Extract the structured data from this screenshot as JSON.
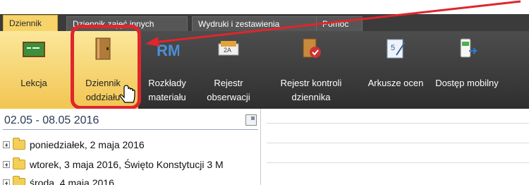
{
  "menu": {
    "tabs": [
      {
        "label": "Dziennik"
      },
      {
        "label": "Dziennik zajęć innych"
      },
      {
        "label": "Wydruki i zestawienia"
      },
      {
        "label": "Pomoc"
      }
    ]
  },
  "ribbon": {
    "buttons": [
      {
        "label": "Lekcja",
        "icon": "lesson-board-icon"
      },
      {
        "label": "Dziennik oddziału",
        "icon": "class-journal-book-icon"
      },
      {
        "label": "Rozkłady materiału",
        "icon": "rm-syllabus-icon"
      },
      {
        "label": "Rejestr obserwacji",
        "icon": "observation-register-icon"
      },
      {
        "label": "Rejestr kontroli dziennika",
        "icon": "journal-control-register-icon"
      },
      {
        "label": "Arkusze ocen",
        "icon": "grade-sheets-icon"
      },
      {
        "label": "Dostęp mobilny",
        "icon": "mobile-access-icon"
      }
    ]
  },
  "left_panel": {
    "date_range": "02.05 - 08.05 2016",
    "days": [
      {
        "label": "poniedziałek, 2 maja 2016"
      },
      {
        "label": "wtorek, 3 maja 2016, Święto Konstytucji 3 M"
      },
      {
        "label": "środa, 4 maja 2016"
      }
    ]
  },
  "colors": {
    "selected_tab": "#f7d46a",
    "ribbon_dark": "#3a3a3a",
    "highlight_red": "#e0252c",
    "folder_yellow": "#f4cf57"
  }
}
